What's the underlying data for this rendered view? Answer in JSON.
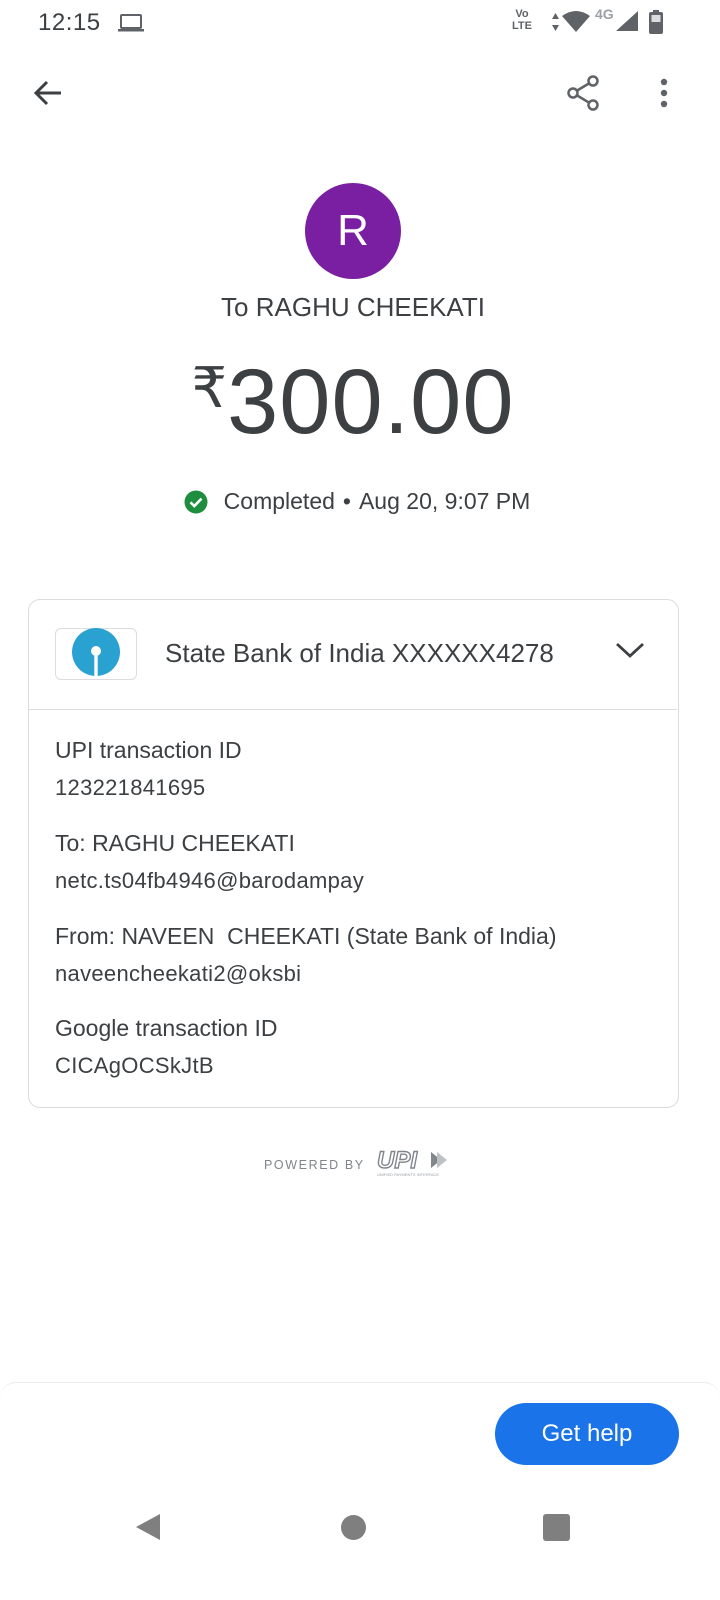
{
  "status_bar": {
    "time": "12:15",
    "volte_top": "Vo",
    "volte_bottom": "LTE",
    "network_type": "4G",
    "icons": [
      "laptop-icon",
      "data-arrows-icon",
      "wifi-icon",
      "signal-icon",
      "battery-icon"
    ]
  },
  "top_bar": {
    "icons": [
      "arrow-back-icon",
      "share-icon",
      "more-vert-icon"
    ]
  },
  "payment": {
    "avatar_letter": "R",
    "avatar_color": "#7b1fa2",
    "recipient_line": "To RAGHU CHEEKATI",
    "currency_symbol": "₹",
    "amount": "300.00",
    "status": "Completed",
    "separator": "•",
    "datetime": "Aug 20, 9:07 PM",
    "status_color": "#1e8e3e"
  },
  "card": {
    "bank_account": "State Bank of India XXXXXX4278",
    "bank_logo": "sbi-logo-icon",
    "details": [
      {
        "label": "UPI transaction ID",
        "value": "123221841695"
      },
      {
        "label": "To: RAGHU CHEEKATI",
        "value": "netc.ts04fb4946@barodampay"
      },
      {
        "label": "From: NAVEEN  CHEEKATI (State Bank of India)",
        "value": "naveencheekati2@oksbi"
      },
      {
        "label": "Google transaction ID",
        "value": "CICAgOCSkJtB"
      }
    ]
  },
  "footer": {
    "powered_by": "POWERED BY",
    "upi_logo_text": "UPI",
    "upi_tagline": "UNIFIED PAYMENTS INTERFACE"
  },
  "help": {
    "label": "Get help",
    "color": "#1a73e8"
  },
  "nav_bar": {
    "icons": [
      "nav-back-icon",
      "nav-home-icon",
      "nav-recents-icon"
    ]
  }
}
